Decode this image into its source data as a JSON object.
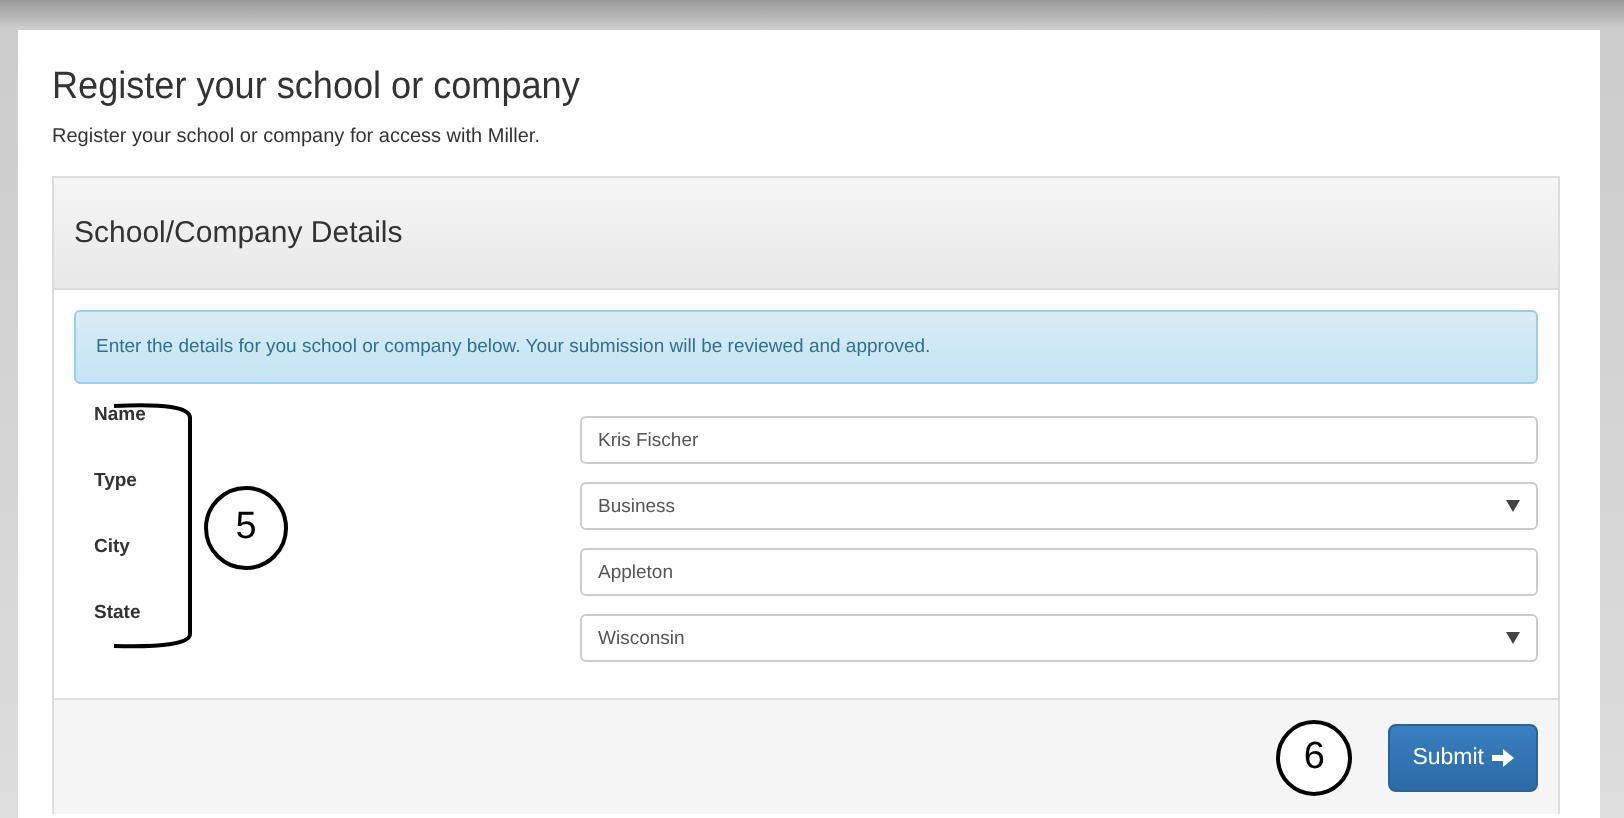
{
  "page": {
    "title": "Register your school or company",
    "subtitle": "Register your school or company for access with Miller."
  },
  "panel": {
    "title": "School/Company Details",
    "alert": "Enter the details for you school or company below. Your submission will be reviewed and approved.",
    "fields": [
      {
        "label": "Name",
        "kind": "input",
        "value": "Kris Fischer"
      },
      {
        "label": "Type",
        "kind": "select",
        "value": "Business"
      },
      {
        "label": "City",
        "kind": "input",
        "value": "Appleton"
      },
      {
        "label": "State",
        "kind": "select",
        "value": "Wisconsin"
      }
    ],
    "submit_button": "Submit"
  },
  "callouts": [
    {
      "kind": "bracket",
      "number": "5"
    },
    {
      "kind": "plain",
      "number": "6"
    }
  ]
}
